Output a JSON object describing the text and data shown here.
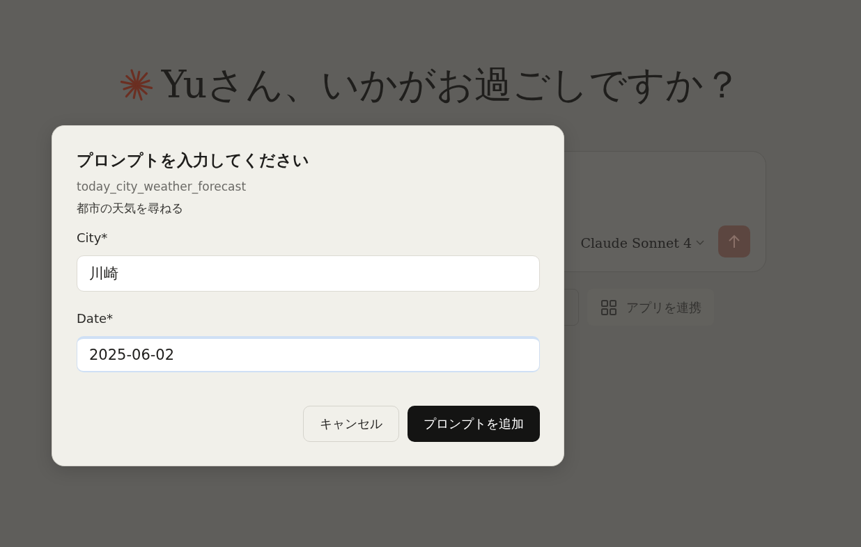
{
  "greeting": {
    "text": "Yuさん、いかがお過ごしですか？"
  },
  "composer": {
    "model": "Claude Sonnet 4"
  },
  "toolbar": {
    "apps_button": "アプリを連携"
  },
  "dialog": {
    "title": "プロンプトを入力してください",
    "prompt_name": "today_city_weather_forecast",
    "description": "都市の天気を尋ねる",
    "fields": [
      {
        "label": "City*",
        "value": "川崎",
        "focused": false
      },
      {
        "label": "Date*",
        "value": "2025-06-02",
        "focused": true
      }
    ],
    "buttons": [
      {
        "label": "キャンセル",
        "kind": "secondary"
      },
      {
        "label": "プロンプトを追加",
        "kind": "primary"
      }
    ]
  }
}
